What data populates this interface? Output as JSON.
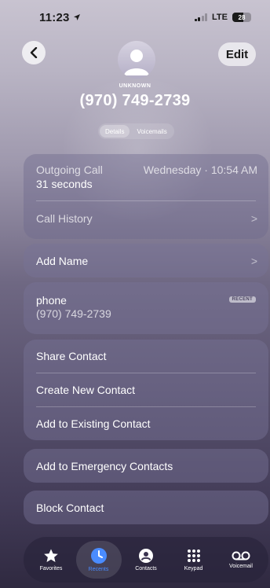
{
  "status_bar": {
    "time": "11:23",
    "network": "LTE",
    "battery": "28"
  },
  "header": {
    "edit_label": "Edit",
    "caller_label": "UNKNOWN",
    "phone_number": "(970) 749-2739",
    "segments": [
      "Details",
      "Voicemails"
    ]
  },
  "call_info": {
    "type": "Outgoing Call",
    "date_time": "Wednesday · 10:54 AM",
    "duration": "31 seconds",
    "history_label": "Call History"
  },
  "add_name_label": "Add Name",
  "phone_entry": {
    "label": "phone",
    "number": "(970) 749-2739",
    "badge": "RECENT"
  },
  "actions": [
    "Share Contact",
    "Create New Contact",
    "Add to Existing Contact"
  ],
  "emergency_label": "Add to Emergency Contacts",
  "block_label": "Block Contact",
  "tabs": [
    {
      "label": "Favorites",
      "icon": "star-icon"
    },
    {
      "label": "Recents",
      "icon": "clock-icon"
    },
    {
      "label": "Contacts",
      "icon": "person-icon"
    },
    {
      "label": "Keypad",
      "icon": "keypad-icon"
    },
    {
      "label": "Voicemail",
      "icon": "voicemail-icon"
    }
  ],
  "colors": {
    "accent": "#4a8cff"
  }
}
